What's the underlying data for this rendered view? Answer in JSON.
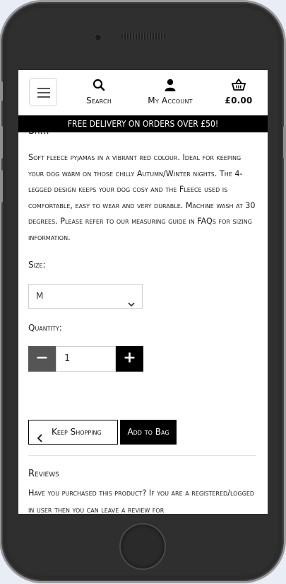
{
  "header": {
    "search_label": "Search",
    "account_label": "My Account",
    "bag_total": "£0.00"
  },
  "banner": {
    "text": "FREE DELIVERY ON ORDERS OVER £50!"
  },
  "product": {
    "title_partial": "Sh...",
    "description": "Soft fleece pyjamas in a vibrant red colour. Ideal for keeping your dog warm on those chilly Autumn/Winter nights. The 4-legged design keeps your dog cosy and the Fleece used is comfortable, easy to wear and very durable. Machine wash at 30 degrees. Please refer to our measuring guide in FAQs for sizing information.",
    "size_label": "Size:",
    "size_selected": "M",
    "quantity_label": "Quantity:",
    "quantity_value": "1",
    "minus_symbol": "−",
    "plus_symbol": "+"
  },
  "actions": {
    "keep_shopping": "Keep Shopping",
    "add_to_bag": "Add to Bag"
  },
  "reviews": {
    "heading": "Reviews",
    "text": "Have you purchased this product? If you are a registered/logged in user then you can leave a review for"
  },
  "icons": {
    "menu": "hamburger-icon",
    "search": "search-icon",
    "account": "user-icon",
    "bag": "basket-icon",
    "select_arrow": "chevron-down-icon",
    "back": "chevron-left-icon"
  }
}
